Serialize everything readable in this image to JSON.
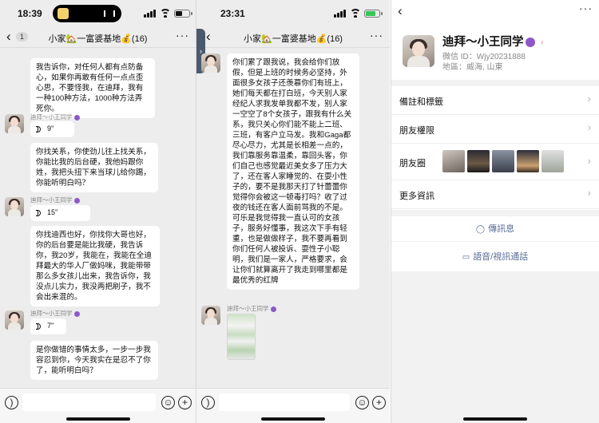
{
  "panel1": {
    "time": "18:39",
    "back_badge": "1",
    "title": "小家🏡一富婆基地💰(16)",
    "messages": [
      {
        "kind": "text",
        "text": "我告诉你，对任何人都有点防备心，如果你再敢有任何一点点歪心思，不要怪我，在迪拜，我有一种100种方法，1000种方法弄死你。"
      },
      {
        "kind": "voice",
        "sender": "迪拜～小王同学",
        "duration": "9''"
      },
      {
        "kind": "text",
        "text": "你找关系，你使劲儿往上找关系，你能比我的后台硬，我他妈跟你姓，我把头扭下来当球儿给你踢，你能听明白吗？"
      },
      {
        "kind": "voice",
        "sender": "迪拜～小王同学",
        "duration": "15''"
      },
      {
        "kind": "text",
        "text": "你找迪西也好，你找你大哥也好，你的后台要是能比我硬，我告诉你，我20岁，我能在，我能在全迪拜最大的华人厂做妈咪，我能带带那么多女孩儿出来，我告诉你，我没点儿实力，我没两把刷子，我不会出来混的。"
      },
      {
        "kind": "voice",
        "sender": "迪拜～小王同学",
        "duration": "7''"
      },
      {
        "kind": "text",
        "text": "是你做错的事情太多，一步一步我容忍到你，今天我实在是忍不了你了，能听明白吗？"
      }
    ]
  },
  "panel2": {
    "time": "23:31",
    "title": "小家🏡一富婆基地💰(16)",
    "message": "你们累了跟我说，我会给你们放假，但是上班的时候务必坚持，外面很多女孩子还羡慕你们有班上，她们每天都在打白班，今天别人家经纪人求我发单我都不发，别人家一空空了8个女孩子，跟我有什么关系，我只关心你们能不能上二班、三班，有客户立马发。我和Gaga都尽心尽力，尤其是长相差一点的，我们靠服务靠温柔，靠回头客，你们自己也感觉最近美女多了压力大了，还在客人家睡觉的、在耍小性子的，要不是我那天打了针蕾蕾你觉得你会被这一顿毒打吗？收了过夜的钱还在客人面前骂我的不是。可乐是我觉得我一直认可的女孩子，服务好懂事，我这次下手有轻重，也是做做样子，我不要再看到你们任何人被投诉、耍性子小聪明，我们是一家人，严格要求，会让你们就算离开了我走到哪里都是最优秀的红牌",
    "sender": "迪拜～小王同学"
  },
  "panel3": {
    "name": "迪拜～小王同学",
    "wechat_id": "微信 ID：Wjy20231888",
    "region": "地區：威海, 山東",
    "rows": [
      {
        "label": "備註和標籤"
      },
      {
        "label": "朋友權限"
      },
      {
        "label": "朋友圈"
      },
      {
        "label": "更多資訊"
      }
    ],
    "send_message": "傳訊息",
    "voice_video_call": "語音/視訊通話"
  },
  "colors": {
    "chat_bg": "#ededed",
    "bubble": "#ffffff",
    "link_blue": "#576b95"
  }
}
